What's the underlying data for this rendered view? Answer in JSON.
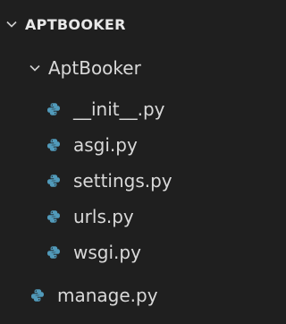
{
  "explorer": {
    "root": {
      "label": "APTBOOKER",
      "icon": "chevron-down-icon"
    },
    "folder": {
      "label": "AptBooker",
      "icon": "chevron-down-icon"
    },
    "folder_files": [
      {
        "label": "__init__.py",
        "icon": "python-file-icon"
      },
      {
        "label": "asgi.py",
        "icon": "python-file-icon"
      },
      {
        "label": "settings.py",
        "icon": "python-file-icon"
      },
      {
        "label": "urls.py",
        "icon": "python-file-icon"
      },
      {
        "label": "wsgi.py",
        "icon": "python-file-icon"
      }
    ],
    "root_files": [
      {
        "label": "manage.py",
        "icon": "python-file-icon"
      }
    ],
    "colors": {
      "background": "#1f1f1f",
      "text": "#d9d9d9",
      "python_icon": "#519aba"
    }
  }
}
